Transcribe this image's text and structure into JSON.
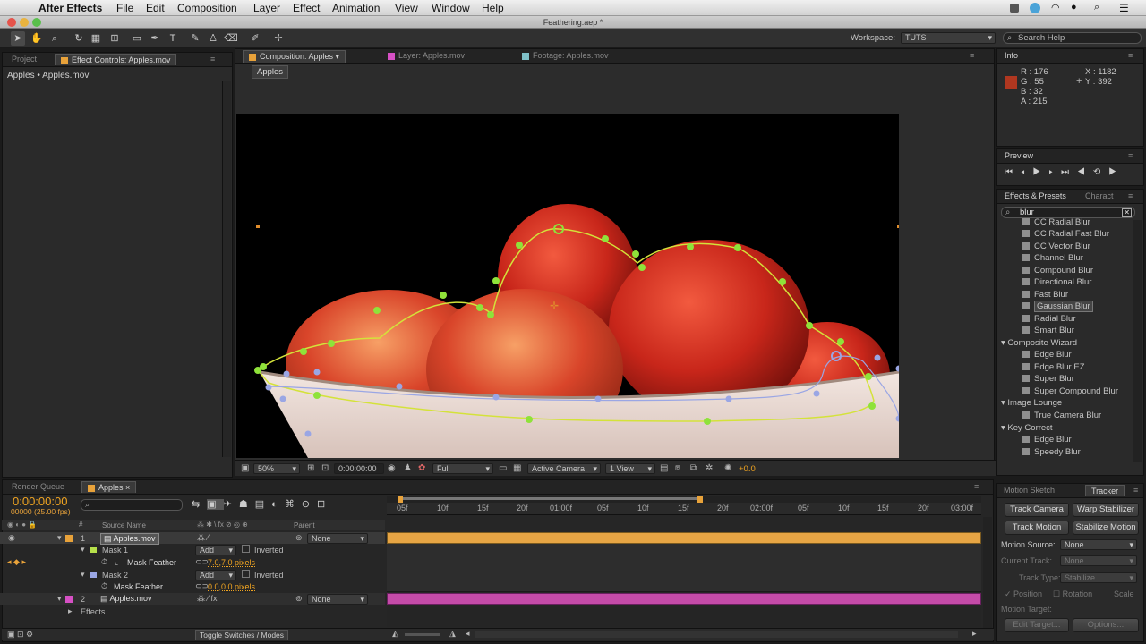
{
  "menubar": {
    "app": "After Effects",
    "items": [
      "File",
      "Edit",
      "Composition",
      "Layer",
      "Effect",
      "Animation",
      "View",
      "Window",
      "Help"
    ]
  },
  "window": {
    "title": "Feathering.aep *"
  },
  "toolbar": {
    "workspace_label": "Workspace:",
    "workspace_value": "TUTS",
    "search_placeholder": "Search Help"
  },
  "project": {
    "tab_project": "Project",
    "tab_effect_controls": "Effect Controls: Apples.mov",
    "path": "Apples • Apples.mov"
  },
  "viewer": {
    "tab_comp": "Composition: Apples",
    "tab_layer": "Layer: Apples.mov",
    "tab_footage": "Footage: Apples.mov",
    "comp_crumb": "Apples",
    "zoom": "50%",
    "timecode": "0:00:00:00",
    "resolution": "Full",
    "camera": "Active Camera",
    "views": "1 View",
    "exposure": "+0.0"
  },
  "info": {
    "title": "Info",
    "r": "R : 176",
    "g": "G : 55",
    "b": "B : 32",
    "a": "A : 215",
    "x": "X : 1182",
    "y": "Y : 392",
    "color": "#b03720"
  },
  "preview": {
    "title": "Preview"
  },
  "effects": {
    "title": "Effects & Presets",
    "tab2": "Charact",
    "search": "blur",
    "blur_items": [
      "CC Radial Blur",
      "CC Radial Fast Blur",
      "CC Vector Blur",
      "Channel Blur",
      "Compound Blur",
      "Directional Blur",
      "Fast Blur",
      "Gaussian Blur",
      "Radial Blur",
      "Smart Blur"
    ],
    "composite_cat": "Composite Wizard",
    "composite_items": [
      "Edge Blur",
      "Edge Blur EZ",
      "Super Blur",
      "Super Compound Blur"
    ],
    "lounge_cat": "Image Lounge",
    "lounge_items": [
      "True Camera Blur"
    ],
    "key_cat": "Key Correct",
    "key_items": [
      "Edge Blur",
      "Speedy Blur"
    ]
  },
  "timeline": {
    "tab_render": "Render Queue",
    "tab_comp": "Apples",
    "timecode": "0:00:00:00",
    "fps": "00000 (25.00 fps)",
    "col_source": "Source Name",
    "col_parent": "Parent",
    "layer1": {
      "num": "1",
      "name": "Apples.mov",
      "parent": "None"
    },
    "mask1": {
      "name": "Mask 1",
      "mode": "Add",
      "inverted": "Inverted",
      "feather_label": "Mask Feather",
      "feather_value": "7.0,7.0 pixels"
    },
    "mask2": {
      "name": "Mask 2",
      "mode": "Add",
      "inverted": "Inverted",
      "feather_label": "Mask Feather",
      "feather_value": "0.0,0.0 pixels"
    },
    "layer2": {
      "num": "2",
      "name": "Apples.mov",
      "parent": "None"
    },
    "effects_label": "Effects",
    "toggle": "Toggle Switches / Modes",
    "ruler": [
      "05f",
      "10f",
      "15f",
      "20f",
      "01:00f",
      "05f",
      "10f",
      "15f",
      "20f",
      "02:00f",
      "05f",
      "10f",
      "15f",
      "20f",
      "03:00f"
    ],
    "bar1_color": "#e7a544",
    "bar2_color": "#c44ba8"
  },
  "tracker": {
    "tab_motion": "Motion Sketch",
    "tab_tracker": "Tracker",
    "track_camera": "Track Camera",
    "warp": "Warp Stabilizer",
    "track_motion": "Track Motion",
    "stabilize": "Stabilize Motion",
    "source_label": "Motion Source:",
    "source_value": "None",
    "current_label": "Current Track:",
    "current_value": "None",
    "type_label": "Track Type:",
    "type_value": "Stabilize",
    "position": "Position",
    "rotation": "Rotation",
    "scale": "Scale",
    "target_label": "Motion Target:",
    "edit_target": "Edit Target...",
    "options": "Options..."
  }
}
